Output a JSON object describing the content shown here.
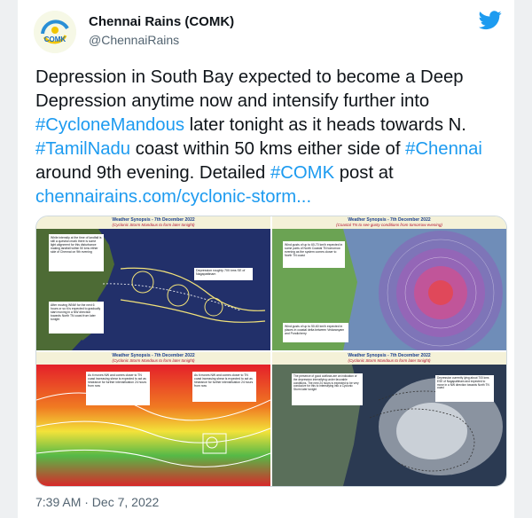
{
  "tweet": {
    "display_name": "Chennai Rains (COMK)",
    "handle": "@ChennaiRains",
    "avatar_text": "COMK",
    "text_parts": [
      {
        "text": "Depression in South Bay expected to become a Deep Depression anytime now and intensify further into ",
        "link": false
      },
      {
        "text": "#CycloneMandous",
        "link": true
      },
      {
        "text": " later tonight as it heads towards N. ",
        "link": false
      },
      {
        "text": "#TamilNadu",
        "link": true
      },
      {
        "text": " coast within 50 kms either side of ",
        "link": false
      },
      {
        "text": "#Chennai",
        "link": true
      },
      {
        "text": " around 9th evening. Detailed ",
        "link": false
      },
      {
        "text": "#COMK",
        "link": true
      },
      {
        "text": " post at ",
        "link": false
      },
      {
        "text": "chennairains.com/cyclonic-storm...",
        "link": true
      }
    ],
    "timestamp": "7:39 AM · Dec 7, 2022"
  },
  "media": {
    "panels": [
      {
        "title": "Weather Synopsis - 7th December 2022",
        "subtitle": "(Cyclonic Storm Mandous to form later tonight)",
        "note_a": "While intensity at the time of landfall is still a question mark there is some light alignment for this disturbance making landfall within 50 kms either side of Chennai on 9th evening",
        "note_b": "After moving WNW for the next 6 hours or so it is expected to gradually start moving in a NW direction towards North TN coast from later tonight",
        "note_c": "Depression roughly 700 kms SE of Nagapattinam"
      },
      {
        "title": "Weather Synopsis - 7th December 2022",
        "subtitle": "(Coastal TN to see gusty conditions from tomorrow evening)",
        "note_a": "Wind gusts of up to 60-70 km/h expected in some parts of North Coastal TN tomorrow evening as the system comes closer to North TN coast",
        "note_b": "Wind gusts of up to 50-60 km/h expected in places in coastal delta between Vedaranyam and Pondicherry"
      },
      {
        "title": "Weather Synopsis - 7th December 2022",
        "subtitle": "(Cyclonic Storm Mandous to form later tonight)",
        "note_a": "As it moves NW and comes closer to TN coast increasing shear is expected to act as hindrance for further intensification 24 hours from now",
        "note_b": "As it moves NW and comes closer to TN coast increasing shear is expected to act as hindrance for further intensification 24 hours from now"
      },
      {
        "title": "Weather Synopsis - 7th December 2022",
        "subtitle": "(Cyclonic Storm Mandous to form later tonight)",
        "note_a": "The presence of good outflows are an indication of the depression intensifying under favorable conditions. The next 24 hours is expected to be very conducive for this to intensifying into a Cyclonic Storm later tonight",
        "note_b": "Depression currently lying about 700 kms ESE of Nagapattinam and expected to move in a NW direction towards North TN coast"
      }
    ]
  },
  "colors": {
    "link": "#1d9bf0",
    "text": "#0f1419",
    "secondary": "#536471",
    "twitter_blue": "#1d9bf0"
  }
}
